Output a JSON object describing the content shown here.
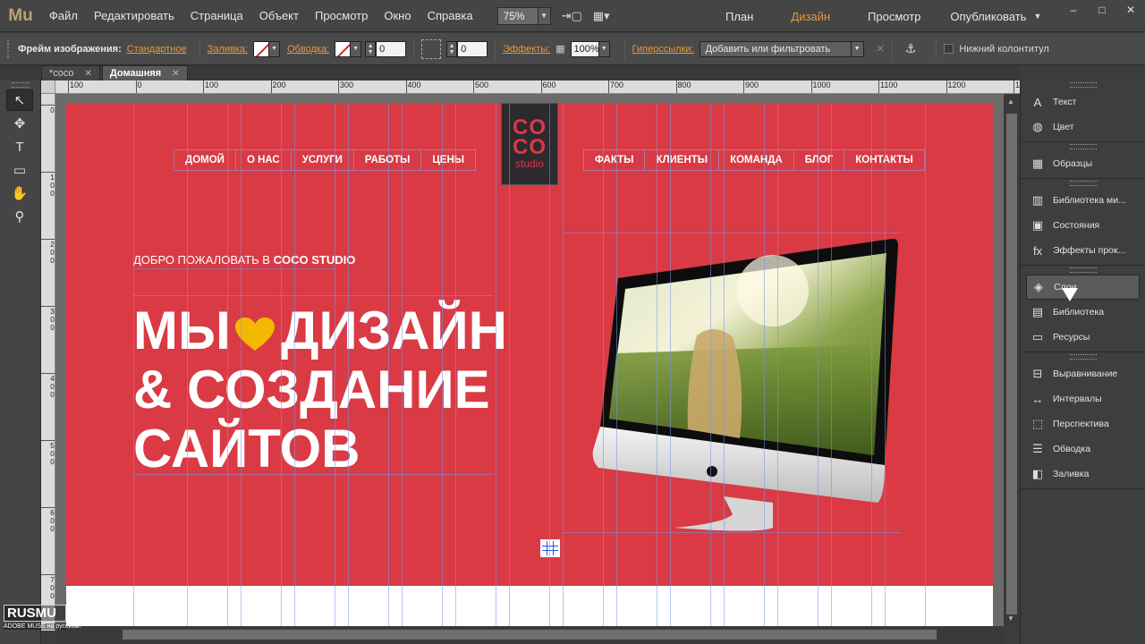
{
  "app": {
    "logo": "Mu"
  },
  "menu": [
    "Файл",
    "Редактировать",
    "Страница",
    "Объект",
    "Просмотр",
    "Окно",
    "Справка"
  ],
  "zoom": "75%",
  "modes": [
    {
      "label": "План",
      "active": false
    },
    {
      "label": "Дизайн",
      "active": true
    },
    {
      "label": "Просмотр",
      "active": false
    }
  ],
  "publish": "Опубликовать",
  "window_controls": {
    "minimize": "–",
    "maximize": "□",
    "close": "✕"
  },
  "control_bar": {
    "frame_label": "Фрейм изображения:",
    "frame_value": "Стандартное",
    "fill_label": "Заливка:",
    "stroke_label": "Обводка:",
    "stroke_width": "0",
    "corner_radius": "0",
    "effects_label": "Эффекты:",
    "opacity": "100%",
    "hyperlinks_label": "Гиперссылки:",
    "hyperlinks_value": "Добавить или фильтровать",
    "footer_label": "Нижний колонтитул"
  },
  "doc_tabs": [
    {
      "label": "*coco",
      "active": false
    },
    {
      "label": "Домашняя",
      "active": true
    }
  ],
  "ruler_top": [
    "100",
    "0",
    "100",
    "200",
    "300",
    "400",
    "500",
    "600",
    "700",
    "800",
    "900",
    "1000",
    "1100",
    "1200",
    "130"
  ],
  "ruler_left": [
    "0",
    "100",
    "200",
    "300",
    "400",
    "500",
    "600",
    "700"
  ],
  "site": {
    "logo_line1": "CO",
    "logo_line2": "CO",
    "logo_sub": "studio",
    "nav_left": [
      "ДОМОЙ",
      "О НАС",
      "УСЛУГИ",
      "РАБОТЫ",
      "ЦЕНЫ"
    ],
    "nav_right": [
      "ФАКТЫ",
      "КЛИЕНТЫ",
      "КОМАНДА",
      "БЛОГ",
      "КОНТАКТЫ"
    ],
    "welcome_prefix": "ДОБРО ПОЖАЛОВАТЬ В ",
    "welcome_brand": "COCO STUDIO",
    "headline_1a": "МЫ",
    "headline_1b": "ДИЗАЙН",
    "headline_2": "& СОЗДАНИЕ",
    "headline_3": "САЙТОВ",
    "hero_color": "#d93a44",
    "heart_color": "#f5b800"
  },
  "panels": [
    [
      {
        "label": "Текст",
        "icon": "A"
      },
      {
        "label": "Цвет",
        "icon": "◍"
      }
    ],
    [
      {
        "label": "Образцы",
        "icon": "▦"
      }
    ],
    [
      {
        "label": "Библиотека ми...",
        "icon": "▥"
      },
      {
        "label": "Состояния",
        "icon": "▣"
      },
      {
        "label": "Эффекты прок...",
        "icon": "fx"
      }
    ],
    [
      {
        "label": "Слои",
        "icon": "◈",
        "active": true
      },
      {
        "label": "Библиотека",
        "icon": "▤"
      },
      {
        "label": "Ресурсы",
        "icon": "▭"
      }
    ],
    [
      {
        "label": "Выравнивание",
        "icon": "⊟"
      },
      {
        "label": "Интервалы",
        "icon": "↔"
      },
      {
        "label": "Перспектива",
        "icon": "⬚"
      },
      {
        "label": "Обводка",
        "icon": "☰"
      },
      {
        "label": "Заливка",
        "icon": "◧"
      }
    ]
  ],
  "watermark": {
    "top": "RUSMU",
    "bottom": "ADOBE MUSE на русском!"
  }
}
